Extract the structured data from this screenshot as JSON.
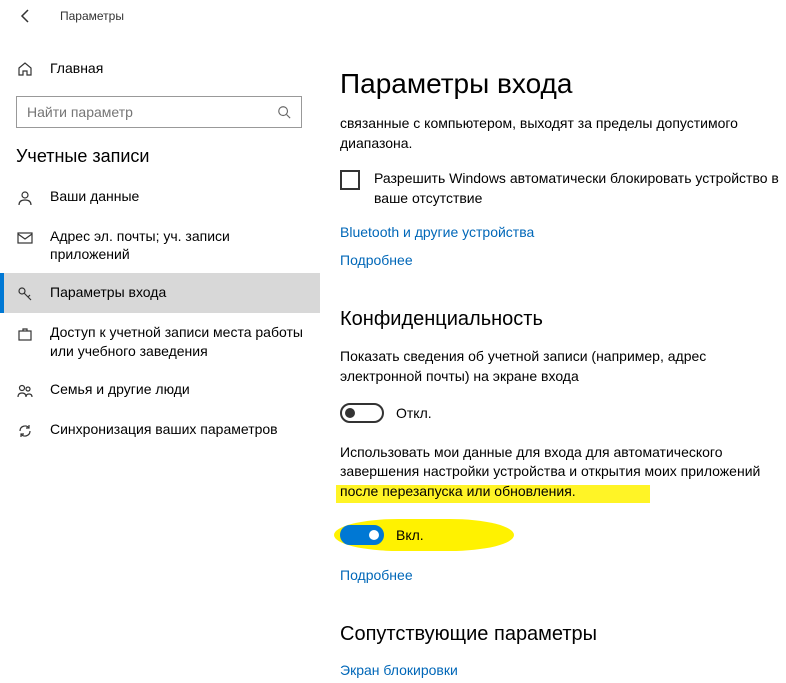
{
  "titlebar": {
    "title": "Параметры"
  },
  "sidebar": {
    "home": "Главная",
    "search_placeholder": "Найти параметр",
    "category": "Учетные записи",
    "items": [
      {
        "label": "Ваши данные"
      },
      {
        "label": "Адрес эл. почты; уч. записи приложений"
      },
      {
        "label": "Параметры входа"
      },
      {
        "label": "Доступ к учетной записи места работы или учебного заведения"
      },
      {
        "label": "Семья и другие люди"
      },
      {
        "label": "Синхронизация ваших параметров"
      }
    ]
  },
  "content": {
    "page_title": "Параметры входа",
    "lock_desc": "связанные с компьютером, выходят за пределы допустимого диапазона.",
    "checkbox_label": "Разрешить Windows автоматически блокировать устройство в ваше отсутствие",
    "bt_link": "Bluetooth и другие устройства",
    "more_link": "Подробнее",
    "privacy_section": "Конфиденциальность",
    "privacy_desc1": "Показать сведения об учетной записи (например, адрес электронной почты) на экране входа",
    "toggle_off": "Откл.",
    "privacy_desc2": "Использовать мои данные для входа для автоматического завершения настройки устройства и открытия моих приложений после перезапуска или обновления.",
    "toggle_on": "Вкл.",
    "more_link2": "Подробнее",
    "related_section": "Сопутствующие параметры",
    "lockscreen_link": "Экран блокировки"
  }
}
